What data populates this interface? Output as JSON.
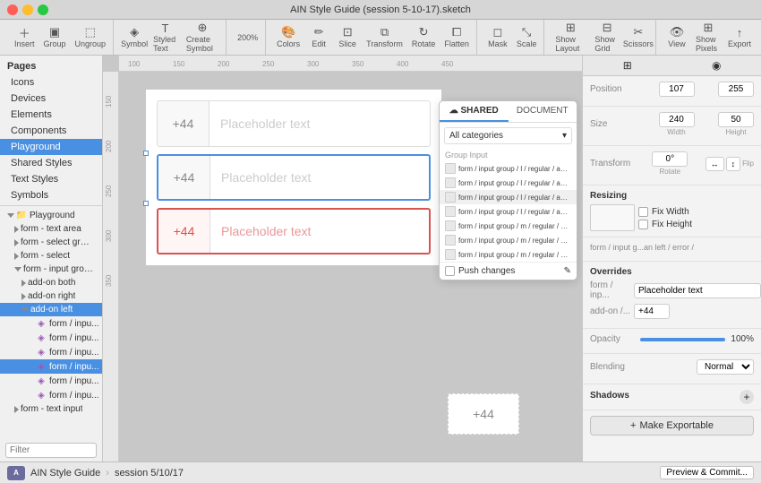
{
  "titlebar": {
    "title": "AIN Style Guide (session 5-10-17).sketch"
  },
  "toolbar": {
    "insert_label": "Insert",
    "group_label": "Group",
    "ungroup_label": "Ungroup",
    "symbol_label": "Symbol",
    "styled_text_label": "Styled Text",
    "create_symbol_label": "Create Symbol",
    "zoom_label": "200%",
    "colors_label": "Colors",
    "edit_label": "Edit",
    "slice_label": "Slice",
    "transform_label": "Transform",
    "rotate_label": "Rotate",
    "flatten_label": "Flatten",
    "mask_label": "Mask",
    "scale_label": "Scale",
    "show_layout_label": "Show Layout",
    "show_grid_label": "Show Grid",
    "scissors_label": "Scissors",
    "view_label": "View",
    "show_pixels_label": "Show Pixels",
    "export_label": "Export"
  },
  "sidebar": {
    "section_title": "Pages",
    "items": [
      {
        "label": "Icons"
      },
      {
        "label": "Devices"
      },
      {
        "label": "Elements"
      },
      {
        "label": "Components"
      },
      {
        "label": "Playground"
      },
      {
        "label": "Shared Styles"
      },
      {
        "label": "Text Styles"
      },
      {
        "label": "Symbols"
      }
    ],
    "active_item": "Playground"
  },
  "layers": {
    "items": [
      {
        "label": "Playground",
        "indent": 1,
        "type": "group",
        "expanded": true
      },
      {
        "label": "form - text area",
        "indent": 2,
        "type": "group"
      },
      {
        "label": "form - select groups",
        "indent": 2,
        "type": "group"
      },
      {
        "label": "form - select",
        "indent": 2,
        "type": "group"
      },
      {
        "label": "form - input groups",
        "indent": 2,
        "type": "group",
        "expanded": true
      },
      {
        "label": "add-on both",
        "indent": 3,
        "type": "group"
      },
      {
        "label": "add-on right",
        "indent": 3,
        "type": "group"
      },
      {
        "label": "add-on left",
        "indent": 3,
        "type": "group",
        "expanded": true,
        "active": true
      },
      {
        "label": "form / inpu...",
        "indent": 4,
        "type": "symbol"
      },
      {
        "label": "form / inpu...",
        "indent": 4,
        "type": "symbol"
      },
      {
        "label": "form / inpu...",
        "indent": 4,
        "type": "symbol"
      },
      {
        "label": "form / inpu...",
        "indent": 4,
        "type": "symbol",
        "active": true
      },
      {
        "label": "form / inpu...",
        "indent": 4,
        "type": "symbol"
      },
      {
        "label": "form / inpu...",
        "indent": 4,
        "type": "symbol"
      },
      {
        "label": "form - text input",
        "indent": 2,
        "type": "group"
      }
    ],
    "search_placeholder": "Filter"
  },
  "canvas": {
    "ruler_marks": [
      "100",
      "150",
      "200",
      "250",
      "300",
      "350",
      "400",
      "450"
    ],
    "input_rows": [
      {
        "addon": "+44",
        "placeholder": "Placeholder text",
        "style": "default"
      },
      {
        "addon": "+44",
        "placeholder": "Placeholder text",
        "style": "selected-blue"
      },
      {
        "addon": "+44",
        "placeholder": "Placeholder text",
        "style": "selected-red"
      }
    ],
    "bottom_addon": "+44"
  },
  "shared_panel": {
    "tab_shared": "SHARED",
    "tab_document": "DOCUMENT",
    "shared_icon": "☁",
    "dropdown_label": "All categories",
    "group_label": "Group Input",
    "list_items": [
      "form / input group / l / regular / add-on",
      "form / input group / l / regular / add-on",
      "form / input group / l / regular / add-on",
      "form / input group / l / regular / add-on",
      "form / input group / m / regular / add-or",
      "form / input group / m / regular / add-or",
      "form / input group / m / regular / add-or"
    ],
    "push_changes_label": "Push changes"
  },
  "right_panel": {
    "tabs": [
      "align-icon",
      "inspect-icon"
    ],
    "position_label": "Position",
    "position_x": "107",
    "position_y": "255",
    "size_label": "Size",
    "size_w": "240",
    "size_h": "50",
    "transform_label": "Transform",
    "rotate_label": "Rotate",
    "rotate_val": "0°",
    "flip_label": "Flip",
    "resizing_label": "Resizing",
    "fix_width_label": "Fix Width",
    "fix_height_label": "Fix Height",
    "breadcrumb": "form / input g...an left / error /",
    "overrides_title": "Overrides",
    "override_1_label": "form / inp...",
    "override_1_value": "Placeholder text",
    "override_2_label": "add-on /...",
    "override_2_value": "+44",
    "opacity_label": "Opacity",
    "opacity_value": "100%",
    "blending_label": "Blending",
    "blending_value": "Normal",
    "shadows_label": "Shadows",
    "make_exportable_label": "Make Exportable"
  },
  "bottom_bar": {
    "app_icon_label": "AIN",
    "breadcrumb_1": "AIN Style Guide",
    "separator": ">",
    "breadcrumb_2": "session 5/10/17",
    "preview_label": "Preview & Commit..."
  }
}
